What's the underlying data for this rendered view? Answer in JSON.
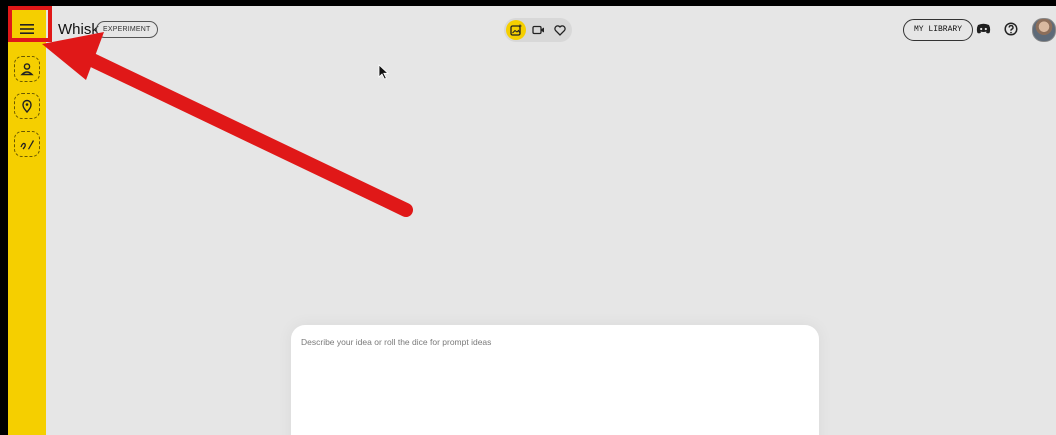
{
  "app": {
    "name": "Whisk",
    "badge": "EXPERIMENT"
  },
  "sidebar": {
    "menu_icon": "hamburger-menu-icon",
    "tools": [
      {
        "name": "subject",
        "icon": "person-icon"
      },
      {
        "name": "scene",
        "icon": "location-pin-icon"
      },
      {
        "name": "style",
        "icon": "brush-icon"
      }
    ]
  },
  "header": {
    "modes": [
      {
        "name": "image",
        "icon": "image-mode-icon",
        "active": true
      },
      {
        "name": "video",
        "icon": "video-mode-icon",
        "active": false
      },
      {
        "name": "favorites",
        "icon": "heart-icon",
        "active": false
      }
    ],
    "library_label": "MY LIBRARY",
    "icons": [
      "discord-icon",
      "help-icon"
    ],
    "avatar": "user-avatar"
  },
  "prompt": {
    "placeholder": "Describe your idea or roll the dice for prompt ideas"
  },
  "colors": {
    "accent": "#f5cf00",
    "background": "#e6e6e6",
    "annotation": "#e01818"
  }
}
